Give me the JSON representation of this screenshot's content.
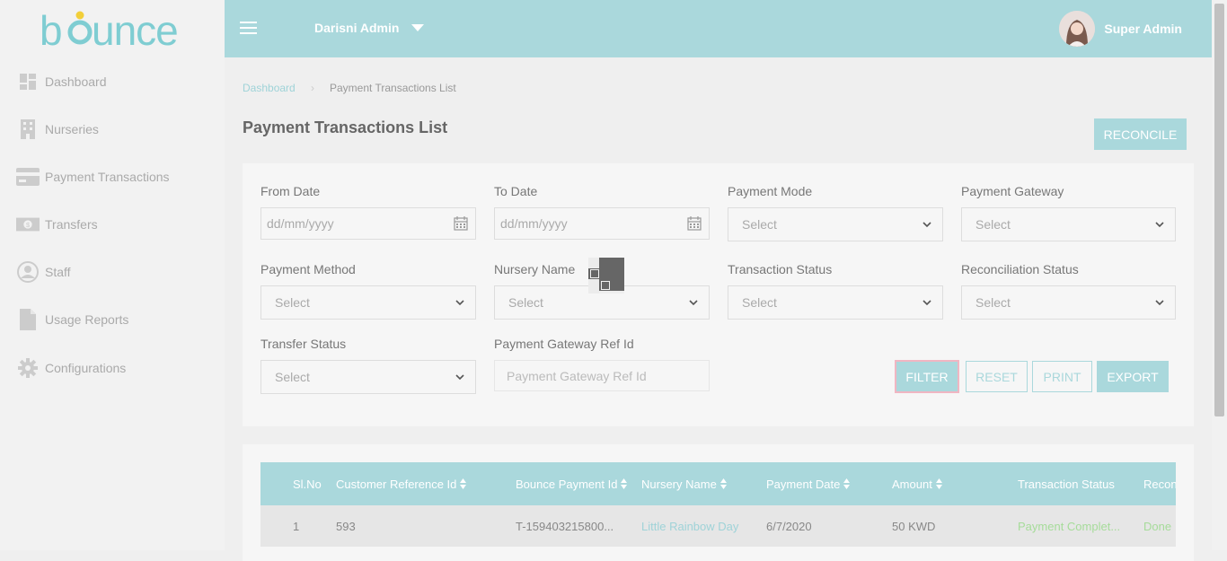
{
  "app": {
    "logo_text": "bounce"
  },
  "sidebar": {
    "items": [
      {
        "label": "Dashboard",
        "icon": "dashboard-icon"
      },
      {
        "label": "Nurseries",
        "icon": "building-icon"
      },
      {
        "label": "Payment Transactions",
        "icon": "credit-card-icon"
      },
      {
        "label": "Transfers",
        "icon": "money-icon"
      },
      {
        "label": "Staff",
        "icon": "user-icon"
      },
      {
        "label": "Usage Reports",
        "icon": "file-icon"
      },
      {
        "label": "Configurations",
        "icon": "gear-icon"
      }
    ]
  },
  "topbar": {
    "org_name": "Darisni Admin",
    "user_name": "Super Admin"
  },
  "breadcrumb": {
    "home": "Dashboard",
    "current": "Payment Transactions List"
  },
  "page": {
    "title": "Payment Transactions List",
    "reconcile_label": "RECONCILE"
  },
  "filters": {
    "from_date": {
      "label": "From Date",
      "placeholder": "dd/mm/yyyy"
    },
    "to_date": {
      "label": "To Date",
      "placeholder": "dd/mm/yyyy"
    },
    "payment_mode": {
      "label": "Payment Mode",
      "value": "Select"
    },
    "payment_gateway": {
      "label": "Payment Gateway",
      "value": "Select"
    },
    "payment_method": {
      "label": "Payment Method",
      "value": "Select"
    },
    "nursery_name": {
      "label": "Nursery Name",
      "value": "Select"
    },
    "transaction_status": {
      "label": "Transaction Status",
      "value": "Select"
    },
    "reconciliation_status": {
      "label": "Reconciliation Status",
      "value": "Select"
    },
    "transfer_status": {
      "label": "Transfer Status",
      "value": "Select"
    },
    "gateway_ref": {
      "label": "Payment Gateway Ref Id",
      "placeholder": "Payment Gateway Ref Id"
    },
    "filter_label": "FILTER",
    "reset_label": "RESET",
    "print_label": "PRINT",
    "export_label": "EXPORT"
  },
  "table": {
    "columns": [
      "Sl.No",
      "Customer Reference Id",
      "Bounce Payment Id",
      "Nursery Name",
      "Payment Date",
      "Amount",
      "Transaction Status",
      "Recon"
    ],
    "rows": [
      {
        "sl": "1",
        "customer_ref": "593",
        "bounce_id": "T-159403215800...",
        "nursery": "Little Rainbow Day",
        "date": "6/7/2020",
        "amount": "50 KWD",
        "status": "Payment Complet...",
        "recon": "Done"
      }
    ]
  },
  "colors": {
    "accent": "#aad8dc",
    "success": "#a6dc9a",
    "link": "#9fd3d8"
  }
}
